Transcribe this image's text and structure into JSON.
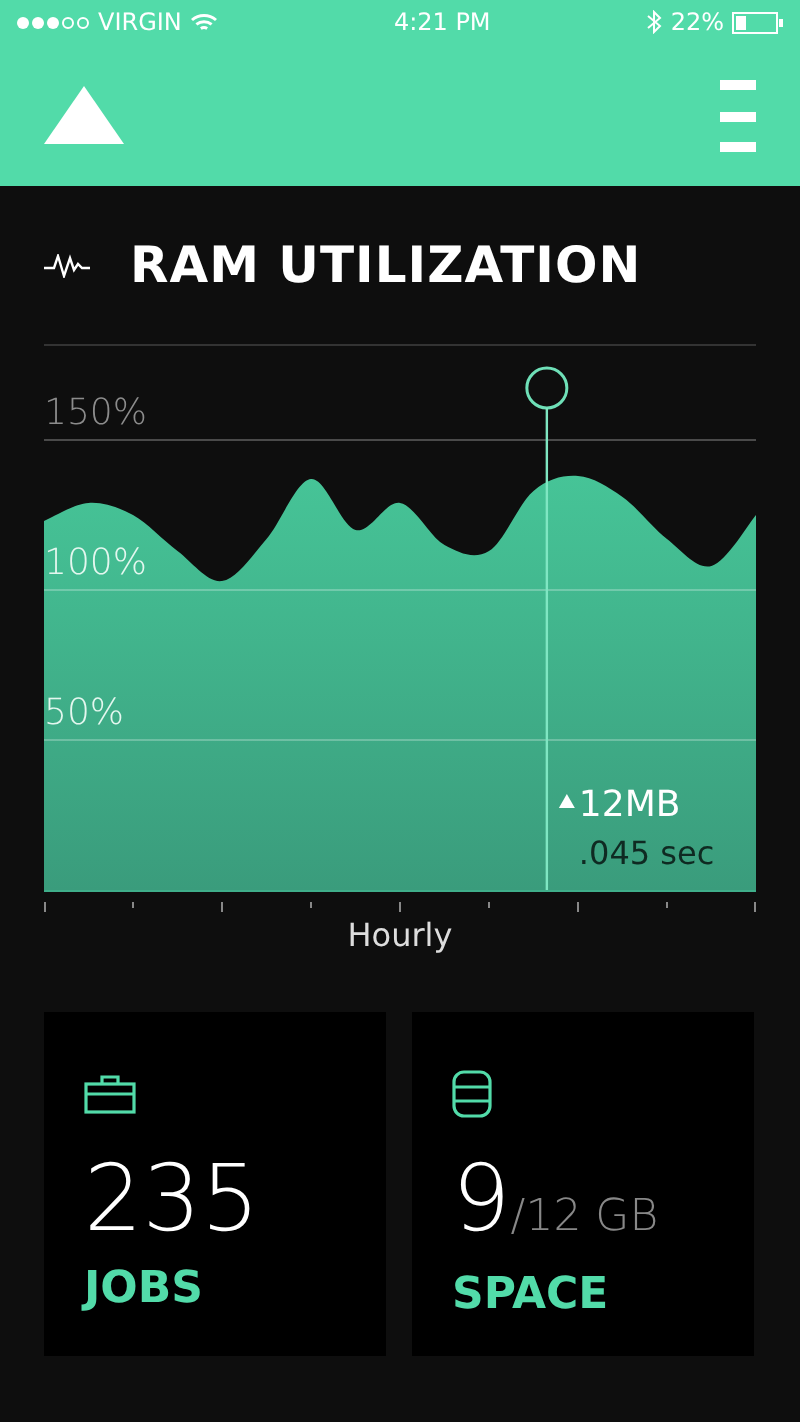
{
  "status_bar": {
    "carrier": "VIRGIN",
    "time": "4:21 PM",
    "battery": "22%"
  },
  "panel": {
    "title": "RAM UTILIZATION",
    "grid_labels": [
      "150%",
      "100%",
      "50%"
    ],
    "marker": {
      "value": "12MB",
      "time": ".045 sec"
    },
    "x_label": "Hourly"
  },
  "cards": [
    {
      "value": "235",
      "label": "JOBS"
    },
    {
      "value": "9",
      "unit": "/12 GB",
      "label": "SPACE"
    }
  ]
}
